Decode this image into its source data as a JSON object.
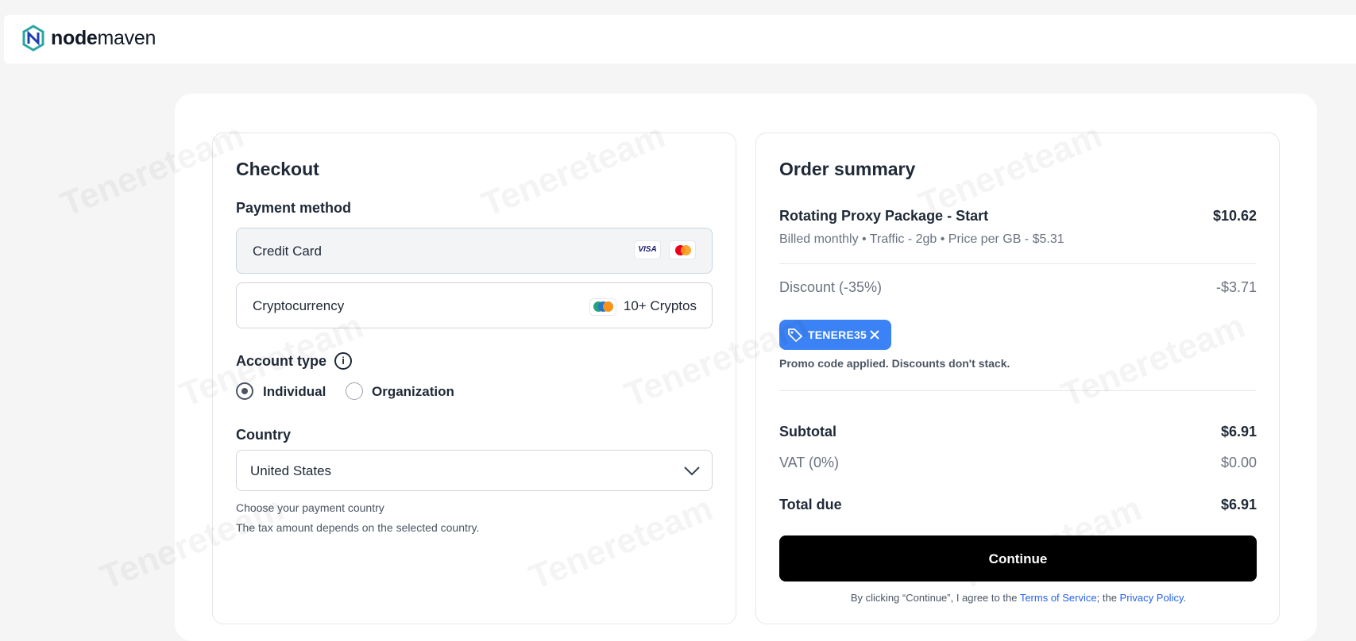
{
  "brand": {
    "name_bold": "node",
    "name_light": "maven"
  },
  "checkout": {
    "title": "Checkout",
    "payment_method_label": "Payment method",
    "options": [
      {
        "name": "Credit Card",
        "cards": [
          "VISA",
          "mastercard"
        ]
      },
      {
        "name": "Cryptocurrency",
        "extra": "10+ Cryptos"
      }
    ],
    "account_type_label": "Account type",
    "account_types": [
      "Individual",
      "Organization"
    ],
    "account_type_selected": "Individual",
    "country_label": "Country",
    "country_value": "United States",
    "country_hint_1": "Choose your payment country",
    "country_hint_2": "The tax amount depends on the selected country."
  },
  "summary": {
    "title": "Order summary",
    "item_name": "Rotating Proxy Package - Start",
    "item_price": "$10.62",
    "item_details": "Billed monthly • Traffic - 2gb • Price per GB - $5.31",
    "discount_label": "Discount (-35%)",
    "discount_value": "-$3.71",
    "promo_code": "TENERE35",
    "promo_note": "Promo code applied. Discounts don't stack.",
    "subtotal_label": "Subtotal",
    "subtotal_value": "$6.91",
    "vat_label": "VAT (0%)",
    "vat_value": "$0.00",
    "total_label": "Total due",
    "total_value": "$6.91",
    "continue_label": "Continue",
    "terms_prefix": "By clicking “Continue”, I agree to the ",
    "terms_link": "Terms of Service",
    "terms_middle": "; the ",
    "privacy_link": "Privacy Policy",
    "terms_suffix": "."
  },
  "watermark": "Tenereteam",
  "colors": {
    "accent": "#3b82f6",
    "button": "#000000",
    "link": "#2563eb"
  }
}
